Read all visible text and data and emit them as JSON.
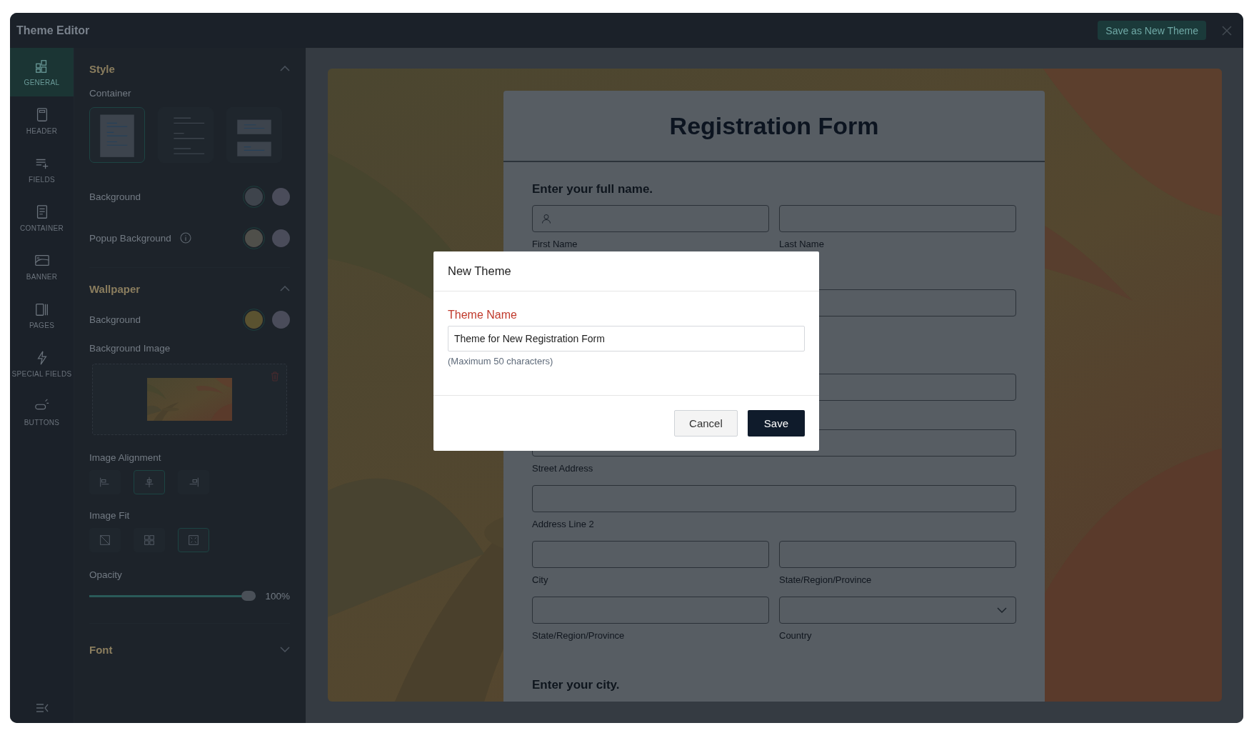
{
  "window": {
    "title": "Theme Editor",
    "save_as_new_button": "Save as New Theme"
  },
  "nav": [
    {
      "kind": "general",
      "label": "GENERAL",
      "selected": true
    },
    {
      "kind": "header",
      "label": "HEADER",
      "selected": false
    },
    {
      "kind": "fields",
      "label": "FIELDS",
      "selected": false
    },
    {
      "kind": "container",
      "label": "CONTAINER",
      "selected": false
    },
    {
      "kind": "banner",
      "label": "BANNER",
      "selected": false
    },
    {
      "kind": "pages",
      "label": "PAGES",
      "selected": false
    },
    {
      "kind": "special",
      "label": "SPECIAL FIELDS",
      "selected": false
    },
    {
      "kind": "buttons",
      "label": "BUTTONS",
      "selected": false
    }
  ],
  "style": {
    "title": "Style",
    "expanded": true,
    "container_label": "Container",
    "container_options": [
      {
        "kind": "card",
        "selected": true
      },
      {
        "kind": "lines",
        "selected": false
      },
      {
        "kind": "blocks",
        "selected": false
      }
    ],
    "color_rows": [
      {
        "label": "Background",
        "info": false,
        "swatches": [
          {
            "color": "#3e444c",
            "selected": true
          },
          {
            "color": "#4a4c5a",
            "selected": false
          }
        ]
      },
      {
        "label": "Popup Background",
        "info": true,
        "swatches": [
          {
            "color": "#4f4f4a",
            "selected": true
          },
          {
            "color": "#4a4c5a",
            "selected": false
          }
        ]
      }
    ]
  },
  "wallpaper": {
    "title": "Wallpaper",
    "expanded": true,
    "background": {
      "label": "Background",
      "swatches": [
        {
          "color": "#5a5230",
          "selected": true
        },
        {
          "color": "#4a4c5a",
          "selected": false
        }
      ]
    },
    "image_label": "Background Image",
    "alignment_label": "Image Alignment",
    "alignment_options": [
      {
        "kind": "left",
        "selected": false
      },
      {
        "kind": "center",
        "selected": true
      },
      {
        "kind": "right",
        "selected": false
      }
    ],
    "fit_label": "Image Fit",
    "fit_options": [
      {
        "kind": "none",
        "selected": false
      },
      {
        "kind": "tile",
        "selected": false
      },
      {
        "kind": "cover",
        "selected": true
      }
    ],
    "opacity_label": "Opacity",
    "opacity": {
      "level": 1,
      "reading": "100%"
    }
  },
  "font": {
    "title": "Font",
    "expanded": false
  },
  "form": {
    "title": "Registration Form",
    "blocks": [
      {
        "kind": "heading",
        "text": "Enter your full name."
      },
      {
        "kind": "row",
        "fields": [
          {
            "kind": "name",
            "label": "First Name"
          },
          {
            "kind": "text",
            "label": "Last Name"
          }
        ]
      },
      {
        "kind": "row",
        "fields": [
          {
            "kind": "text"
          }
        ]
      },
      {
        "kind": "row",
        "fields": [
          {
            "kind": "text"
          }
        ]
      },
      {
        "kind": "row",
        "fields": [
          {
            "kind": "text",
            "label": "Street Address"
          }
        ]
      },
      {
        "kind": "row",
        "fields": [
          {
            "kind": "text",
            "label": "Address Line 2"
          }
        ]
      },
      {
        "kind": "row",
        "fields": [
          {
            "kind": "text",
            "label": "City"
          },
          {
            "kind": "text",
            "label": "State/Region/Province"
          }
        ]
      },
      {
        "kind": "row",
        "fields": [
          {
            "kind": "text",
            "label": "State/Region/Province"
          },
          {
            "kind": "dropdown",
            "label": "Country"
          }
        ]
      },
      {
        "kind": "heading",
        "text": "Enter your city."
      }
    ]
  },
  "modal": {
    "title": "New Theme",
    "field_label": "Theme Name",
    "value": "Theme for New Registration Form",
    "hint": "(Maximum 50 characters)",
    "cancel": "Cancel",
    "save": "Save"
  }
}
